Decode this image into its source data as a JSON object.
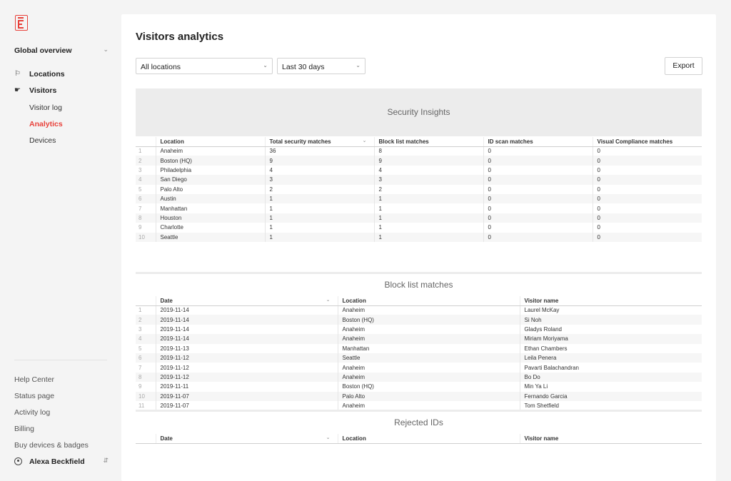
{
  "sidebar": {
    "org": "Global overview",
    "nav": [
      {
        "label": "Locations",
        "icon": "flag-icon"
      },
      {
        "label": "Visitors",
        "icon": "visitor-icon"
      }
    ],
    "sub": [
      {
        "label": "Visitor log"
      },
      {
        "label": "Analytics",
        "active": true
      },
      {
        "label": "Devices"
      }
    ],
    "footer": [
      "Help Center",
      "Status page",
      "Activity log",
      "Billing",
      "Buy devices & badges"
    ],
    "user": "Alexa Beckfield"
  },
  "header": {
    "title": "Visitors analytics",
    "location_filter": "All locations",
    "date_filter": "Last 30 days",
    "export_label": "Export"
  },
  "security": {
    "title": "Security Insights",
    "columns": [
      "Location",
      "Total security matches",
      "Block list matches",
      "ID scan matches",
      "Visual Compliance matches"
    ],
    "rows": [
      [
        "1",
        "Anaheim",
        "36",
        "8",
        "0",
        "0"
      ],
      [
        "2",
        "Boston (HQ)",
        "9",
        "9",
        "0",
        "0"
      ],
      [
        "3",
        "Philadelphia",
        "4",
        "4",
        "0",
        "0"
      ],
      [
        "4",
        "San Diego",
        "3",
        "3",
        "0",
        "0"
      ],
      [
        "5",
        "Palo Alto",
        "2",
        "2",
        "0",
        "0"
      ],
      [
        "6",
        "Austin",
        "1",
        "1",
        "0",
        "0"
      ],
      [
        "7",
        "Manhattan",
        "1",
        "1",
        "0",
        "0"
      ],
      [
        "8",
        "Houston",
        "1",
        "1",
        "0",
        "0"
      ],
      [
        "9",
        "Charlotte",
        "1",
        "1",
        "0",
        "0"
      ],
      [
        "10",
        "Seattle",
        "1",
        "1",
        "0",
        "0"
      ]
    ]
  },
  "blocklist": {
    "title": "Block list matches",
    "columns": [
      "Date",
      "Location",
      "Visitor name"
    ],
    "rows": [
      [
        "1",
        "2019-11-14",
        "Anaheim",
        "Laurel McKay"
      ],
      [
        "2",
        "2019-11-14",
        "Boston (HQ)",
        "Si Noh"
      ],
      [
        "3",
        "2019-11-14",
        "Anaheim",
        "Gladys Roland"
      ],
      [
        "4",
        "2019-11-14",
        "Anaheim",
        "Miriam Moriyama"
      ],
      [
        "5",
        "2019-11-13",
        "Manhattan",
        "Ethan Chambers"
      ],
      [
        "6",
        "2019-11-12",
        "Seattle",
        "Leila Penera"
      ],
      [
        "7",
        "2019-11-12",
        "Anaheim",
        "Pavarti Balachandran"
      ],
      [
        "8",
        "2019-11-12",
        "Anaheim",
        "Bo Do"
      ],
      [
        "9",
        "2019-11-11",
        "Boston (HQ)",
        "Min Ya Li"
      ],
      [
        "10",
        "2019-11-07",
        "Palo Alto",
        "Fernando Garcia"
      ],
      [
        "11",
        "2019-11-07",
        "Anaheim",
        "Tom Shetfield"
      ]
    ]
  },
  "rejected": {
    "title": "Rejected IDs",
    "columns": [
      "Date",
      "Location",
      "Visitor name"
    ]
  }
}
